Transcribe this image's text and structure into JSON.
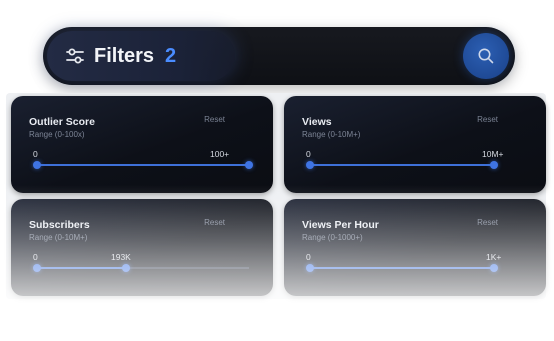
{
  "filter_bar": {
    "label": "Filters",
    "count": "2",
    "icons": {
      "filters": "sliders-icon",
      "search": "search-icon"
    }
  },
  "colors": {
    "accent": "#3e70d8",
    "count_text": "#4a8cff",
    "card_bg": "#0d1018"
  },
  "filters": [
    {
      "title": "Outlier Score",
      "range": "Range (0-100x)",
      "reset": "Reset",
      "min_label": "0",
      "max_label": "100+",
      "selected_fraction": 1.0
    },
    {
      "title": "Views",
      "range": "Range (0-10M+)",
      "reset": "Reset",
      "min_label": "0",
      "max_label": "10M+",
      "selected_fraction": 1.0
    },
    {
      "title": "Subscribers",
      "range": "Range (0-10M+)",
      "reset": "Reset",
      "min_label": "0",
      "max_label": "193K",
      "selected_fraction": 0.42
    },
    {
      "title": "Views Per Hour",
      "range": "Range (0-1000+)",
      "reset": "Reset",
      "min_label": "0",
      "max_label": "1K+",
      "selected_fraction": 1.0
    }
  ]
}
